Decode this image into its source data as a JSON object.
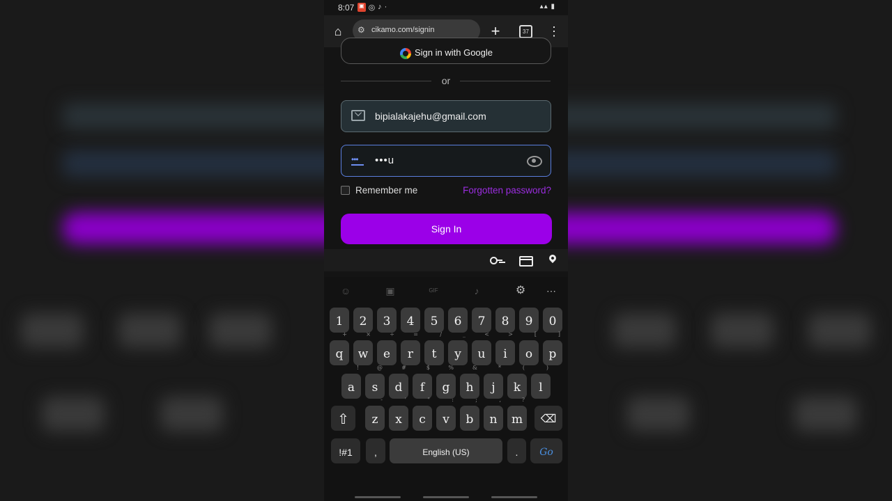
{
  "status_bar": {
    "time": "8:07"
  },
  "browser": {
    "url": "cikamo.com/signin",
    "tab_count": "37"
  },
  "signin_page": {
    "google_button_label": "Sign in with Google",
    "or_label": "or",
    "email_value": "bipialakajehu@gmail.com",
    "password_masked": "•••u",
    "remember_me_label": "Remember me",
    "forgot_password_label": "Forgotten password?",
    "signin_button_label": "Sign In",
    "accent_color": "#9b00e8"
  },
  "keyboard": {
    "number_row": [
      "1",
      "2",
      "3",
      "4",
      "5",
      "6",
      "7",
      "8",
      "9",
      "0"
    ],
    "row1": [
      {
        "k": "q",
        "h": "+"
      },
      {
        "k": "w",
        "h": "×"
      },
      {
        "k": "e",
        "h": "÷"
      },
      {
        "k": "r",
        "h": "="
      },
      {
        "k": "t",
        "h": "/"
      },
      {
        "k": "y",
        "h": "_"
      },
      {
        "k": "u",
        "h": "<"
      },
      {
        "k": "i",
        "h": ">"
      },
      {
        "k": "o",
        "h": "["
      },
      {
        "k": "p",
        "h": "]"
      }
    ],
    "row2": [
      {
        "k": "a",
        "h": "!"
      },
      {
        "k": "s",
        "h": "@"
      },
      {
        "k": "d",
        "h": "#"
      },
      {
        "k": "f",
        "h": "$"
      },
      {
        "k": "g",
        "h": "%"
      },
      {
        "k": "h",
        "h": "&"
      },
      {
        "k": "j",
        "h": "*"
      },
      {
        "k": "k",
        "h": "("
      },
      {
        "k": "l",
        "h": ")"
      }
    ],
    "row3": [
      {
        "k": "z",
        "h": "-"
      },
      {
        "k": "x",
        "h": "'"
      },
      {
        "k": "c",
        "h": "\""
      },
      {
        "k": "v",
        "h": ":"
      },
      {
        "k": "b",
        "h": ";"
      },
      {
        "k": "n",
        "h": ","
      },
      {
        "k": "m",
        "h": "?"
      }
    ],
    "symbols_label": "!#1",
    "comma_label": ",",
    "space_label": "English (US)",
    "period_label": ".",
    "go_label": "Go"
  }
}
